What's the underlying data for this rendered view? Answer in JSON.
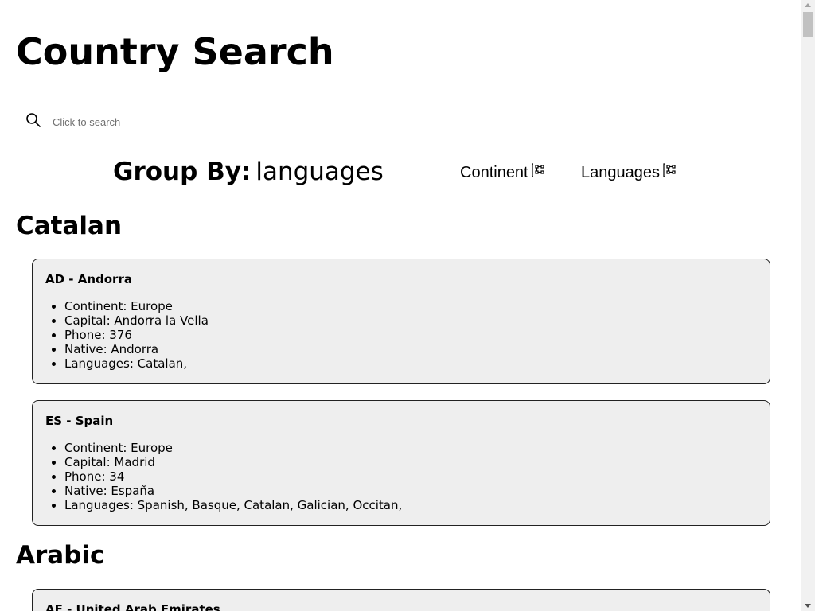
{
  "page": {
    "title": "Country Search"
  },
  "search": {
    "placeholder": "Click to search",
    "icon": "search-icon"
  },
  "group_by": {
    "label": "Group By:",
    "value": "languages",
    "buttons": [
      {
        "label": "Continent",
        "icon": "group-icon"
      },
      {
        "label": "Languages",
        "icon": "group-icon"
      }
    ]
  },
  "groups": [
    {
      "name": "Catalan",
      "countries": [
        {
          "header": "AD - Andorra",
          "details": [
            "Continent: Europe",
            "Capital: Andorra la Vella",
            "Phone: 376",
            "Native: Andorra",
            "Languages: Catalan,"
          ]
        },
        {
          "header": "ES - Spain",
          "details": [
            "Continent: Europe",
            "Capital: Madrid",
            "Phone: 34",
            "Native: España",
            "Languages: Spanish, Basque, Catalan, Galician, Occitan,"
          ]
        }
      ]
    },
    {
      "name": "Arabic",
      "countries": [
        {
          "header": "AE - United Arab Emirates",
          "details": []
        }
      ]
    }
  ]
}
